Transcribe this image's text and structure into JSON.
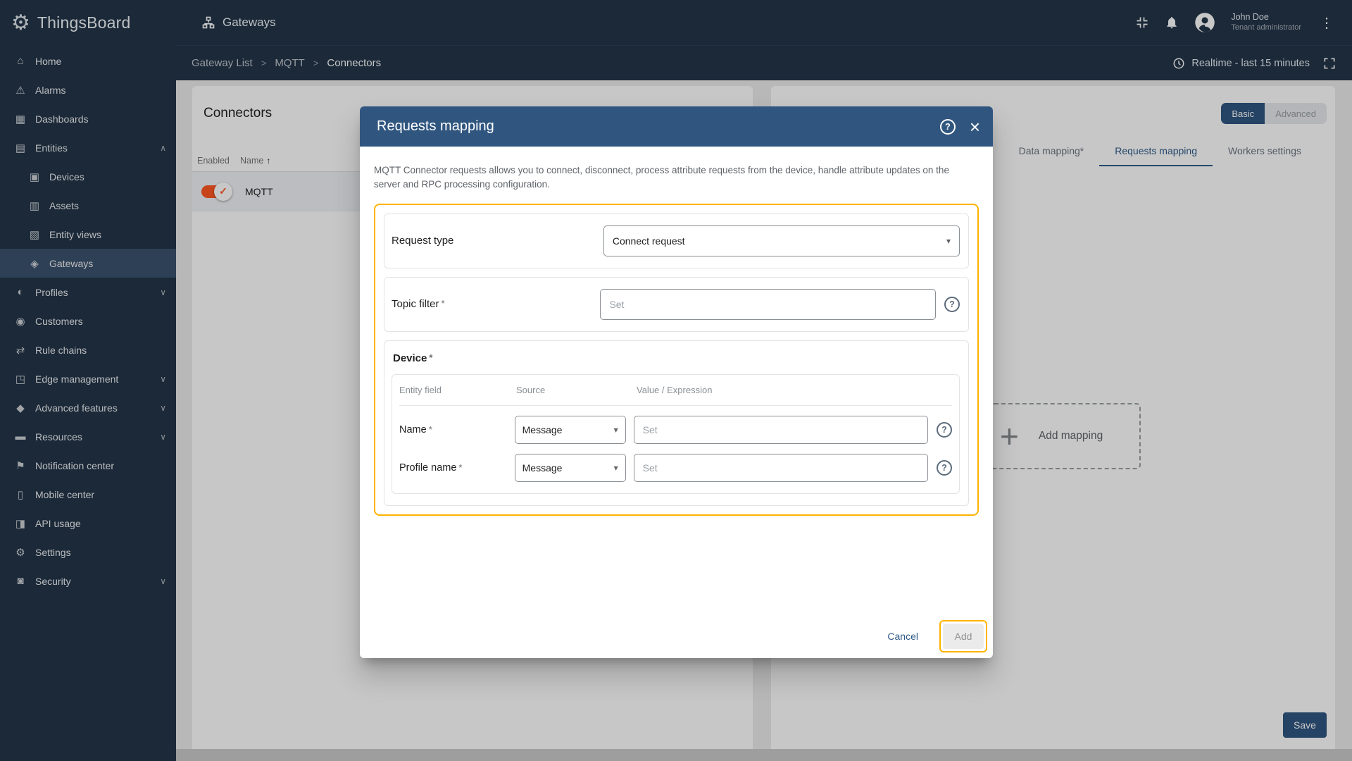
{
  "app": {
    "name": "ThingsBoard"
  },
  "icons": {
    "chevron_down": "∨",
    "chevron_up": "∧",
    "dropdown": "▾",
    "sort_asc": "↑",
    "check": "✓",
    "plus": "+",
    "close": "×",
    "help": "?",
    "kebab": "⋮",
    "gear": "⚙"
  },
  "colors": {
    "accent_blue": "#305680",
    "highlight_amber": "#ffb300",
    "toggle_orange": "#ff5722",
    "sidebar_bg": "#233549"
  },
  "sidebar": {
    "logo_text": "ThingsBoard",
    "items": [
      {
        "label": "Home",
        "icon": "home",
        "glyph": "⌂"
      },
      {
        "label": "Alarms",
        "icon": "alarms",
        "glyph": "⚠"
      },
      {
        "label": "Dashboards",
        "icon": "dashboards",
        "glyph": "▦"
      },
      {
        "label": "Entities",
        "icon": "entities",
        "glyph": "▤",
        "expanded": true
      },
      {
        "label": "Devices",
        "icon": "devices",
        "glyph": "▣",
        "child": true
      },
      {
        "label": "Assets",
        "icon": "assets",
        "glyph": "▥",
        "child": true
      },
      {
        "label": "Entity views",
        "icon": "entity-views",
        "glyph": "▧",
        "child": true
      },
      {
        "label": "Gateways",
        "icon": "gateways",
        "glyph": "◈",
        "child": true,
        "selected": true
      },
      {
        "label": "Profiles",
        "icon": "profiles",
        "glyph": "◐",
        "collapsible": true
      },
      {
        "label": "Customers",
        "icon": "customers",
        "glyph": "◉"
      },
      {
        "label": "Rule chains",
        "icon": "rule-chains",
        "glyph": "⇄"
      },
      {
        "label": "Edge management",
        "icon": "edge-management",
        "glyph": "◳",
        "collapsible": true
      },
      {
        "label": "Advanced features",
        "icon": "advanced-features",
        "glyph": "◆",
        "collapsible": true
      },
      {
        "label": "Resources",
        "icon": "resources",
        "glyph": "▬",
        "collapsible": true
      },
      {
        "label": "Notification center",
        "icon": "notification-center",
        "glyph": "⚑"
      },
      {
        "label": "Mobile center",
        "icon": "mobile-center",
        "glyph": "▯"
      },
      {
        "label": "API usage",
        "icon": "api-usage",
        "glyph": "◨"
      },
      {
        "label": "Settings",
        "icon": "settings",
        "glyph": "⚙"
      },
      {
        "label": "Security",
        "icon": "security",
        "glyph": "◙",
        "collapsible": true
      }
    ]
  },
  "topbar": {
    "title": "Gateways",
    "user_name": "John Doe",
    "user_role": "Tenant administrator"
  },
  "breadcrumb": {
    "item1": "Gateway List",
    "item2": "MQTT",
    "item3": "Connectors",
    "separator": ">",
    "realtime_label": "Realtime - last 15 minutes"
  },
  "connectors_panel": {
    "title": "Connectors",
    "col_enabled": "Enabled",
    "col_name": "Name",
    "rows": [
      {
        "name": "MQTT",
        "enabled": true
      }
    ]
  },
  "config_panel": {
    "basic_label": "Basic",
    "advanced_label": "Advanced",
    "tabs": [
      "Data mapping*",
      "Requests mapping",
      "Workers settings"
    ],
    "active_tab": "Requests mapping",
    "add_mapping_label": "Add mapping",
    "save_label": "Save"
  },
  "modal": {
    "title": "Requests mapping",
    "hint": "MQTT Connector requests allows you to connect, disconnect, process attribute requests from the device, handle attribute updates on the server and RPC processing configuration.",
    "required_marker": "*",
    "request_type_label": "Request type",
    "request_type_value": "Connect request",
    "topic_filter_label": "Topic filter",
    "topic_filter_placeholder": "Set",
    "device_label": "Device",
    "device_columns": {
      "field": "Entity field",
      "source": "Source",
      "value": "Value / Expression"
    },
    "device_rows": [
      {
        "field": "Name",
        "source": "Message",
        "placeholder": "Set"
      },
      {
        "field": "Profile name",
        "source": "Message",
        "placeholder": "Set"
      }
    ],
    "cancel_label": "Cancel",
    "add_label": "Add"
  }
}
